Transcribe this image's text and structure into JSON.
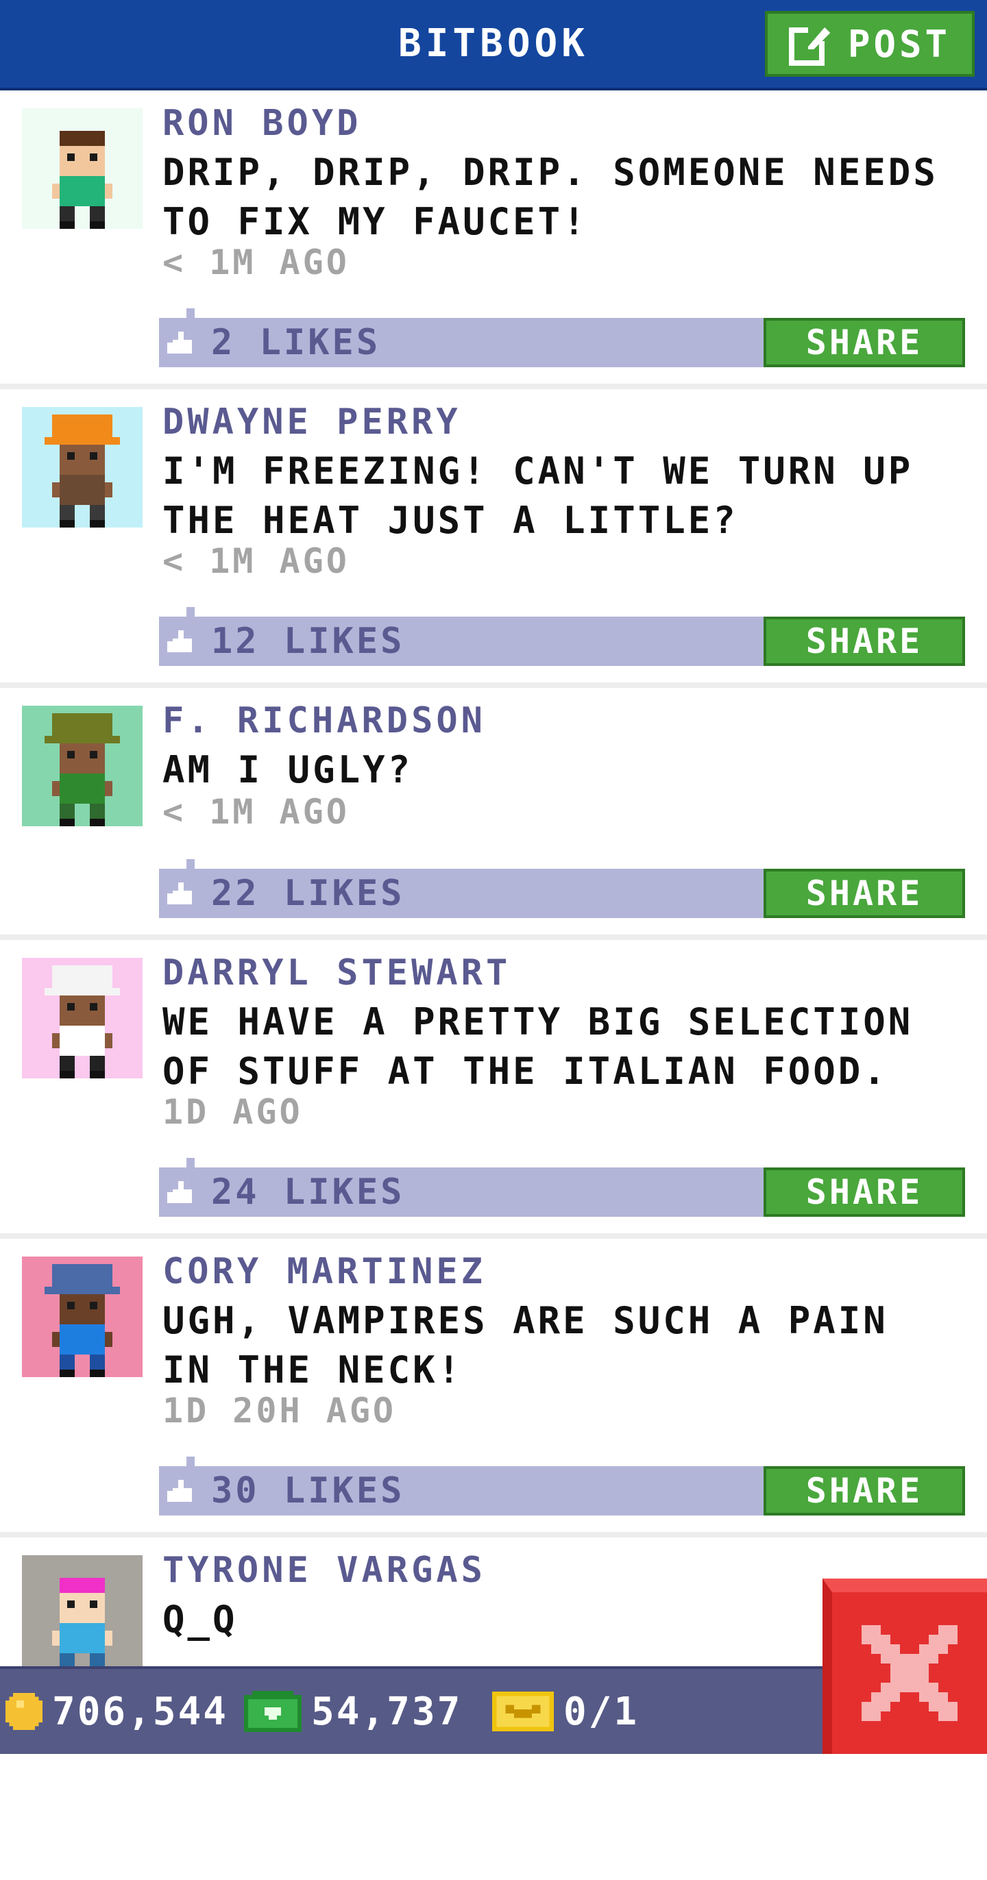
{
  "header": {
    "title": "BITBOOK",
    "post_label": "POST"
  },
  "posts": [
    {
      "author": "RON BOYD",
      "text": "DRIP, DRIP, DRIP. SOMEONE NEEDS TO FIX MY FAUCET!",
      "time": "< 1M AGO",
      "likes": "2 LIKES",
      "share": "SHARE"
    },
    {
      "author": "DWAYNE PERRY",
      "text": "I'M FREEZING! CAN'T WE TURN UP THE HEAT JUST A LITTLE?",
      "time": "< 1M AGO",
      "likes": "12 LIKES",
      "share": "SHARE"
    },
    {
      "author": "F. RICHARDSON",
      "text": "AM I UGLY?",
      "time": "< 1M AGO",
      "likes": "22 LIKES",
      "share": "SHARE"
    },
    {
      "author": "DARRYL STEWART",
      "text": "WE HAVE A PRETTY BIG SELECTION OF STUFF AT THE ITALIAN FOOD.",
      "time": "1D AGO",
      "likes": "24 LIKES",
      "share": "SHARE"
    },
    {
      "author": "CORY MARTINEZ",
      "text": "UGH, VAMPIRES ARE SUCH A PAIN IN THE NECK!",
      "time": "1D 20H AGO",
      "likes": "30 LIKES",
      "share": "SHARE"
    },
    {
      "author": "TYRONE VARGAS",
      "text": "Q_Q"
    }
  ],
  "avatars": [
    {
      "bg": "#eefcf4",
      "hair": "#5a3318",
      "skin": "#f2c79e",
      "shirt": "#23b47a",
      "pants": "#2b2b2b",
      "hat": ""
    },
    {
      "bg": "#c1f0f8",
      "hair": "#2a2a2a",
      "skin": "#8a5a3c",
      "shirt": "#6b4a34",
      "pants": "#3a3a3a",
      "hat": "#f28a1a"
    },
    {
      "bg": "#85d6ad",
      "hair": "#2a2a2a",
      "skin": "#8a5a3c",
      "shirt": "#2f8a2f",
      "pants": "#2f6a2f",
      "hat": "#6f7a23"
    },
    {
      "bg": "#fbc8ee",
      "hair": "#2a2a2a",
      "skin": "#8a5a3c",
      "shirt": "#ffffff",
      "pants": "#222222",
      "hat": "#f4f4f4"
    },
    {
      "bg": "#f08aaa",
      "hair": "#2a2a2a",
      "skin": "#6a4028",
      "shirt": "#1e7ee0",
      "pants": "#1e4ea0",
      "hat": "#4a6aa8"
    },
    {
      "bg": "#a7a39d",
      "hair": "#f030c8",
      "skin": "#f6d8b8",
      "shirt": "#3aaee0",
      "pants": "#2a6aa0",
      "hat": ""
    }
  ],
  "status": {
    "coins": "706,544",
    "bux": "54,737",
    "tickets": "0/1"
  },
  "icons": {
    "post": "edit-icon",
    "like": "thumb-up-icon",
    "coin": "coin-icon",
    "bux": "bux-icon",
    "ticket": "ticket-icon",
    "close": "close-icon"
  },
  "colors": {
    "header": "#14469e",
    "green": "#49a73c",
    "like_bar": "#b3b5d8",
    "name": "#5a5a91",
    "close": "#e52f2f"
  }
}
